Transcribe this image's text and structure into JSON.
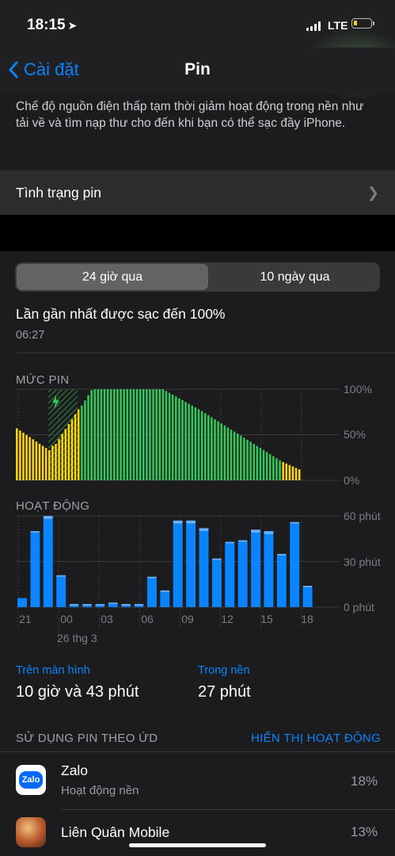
{
  "status_bar": {
    "time": "18:15",
    "network": "LTE"
  },
  "nav": {
    "back_label": "Cài đặt",
    "title": "Pin"
  },
  "low_power_description": "Chế độ nguồn điện thấp tạm thời giảm hoạt động trong nền như tải về và tìm nạp thư cho đến khi bạn có thể sạc đầy iPhone.",
  "battery_health": {
    "label": "Tình trạng pin"
  },
  "segment": {
    "options": [
      "24 giờ qua",
      "10 ngày qua"
    ],
    "selected": 0
  },
  "last_charged": {
    "label": "Lần gần nhất được sạc đến 100%",
    "time": "06:27"
  },
  "chart_data": [
    {
      "type": "bar",
      "title": "MỨC PIN",
      "y_tick_labels": [
        "100%",
        "50%",
        "0%"
      ],
      "ylim": [
        0,
        100
      ],
      "colors": {
        "normal": "#34c759",
        "low_power": "#ffd60a",
        "grid": "#3a3a3c"
      },
      "bars": 88,
      "segments": [
        {
          "from": 0,
          "to": 11,
          "start": 57,
          "end": 33,
          "mode": "low_power"
        },
        {
          "from": 11,
          "to": 12,
          "start": 38,
          "end": 38,
          "mode": "low_power"
        },
        {
          "from": 12,
          "to": 20,
          "start": 40,
          "end": 78,
          "mode": "low_power"
        },
        {
          "from": 20,
          "to": 24,
          "start": 82,
          "end": 99,
          "mode": "normal"
        },
        {
          "from": 24,
          "to": 46,
          "start": 100,
          "end": 100,
          "mode": "normal"
        },
        {
          "from": 46,
          "to": 57,
          "start": 98,
          "end": 78,
          "mode": "normal"
        },
        {
          "from": 57,
          "to": 82,
          "start": 76,
          "end": 22,
          "mode": "normal"
        },
        {
          "from": 82,
          "to": 88,
          "start": 20,
          "end": 12,
          "mode": "low_power"
        }
      ],
      "charging_window": {
        "from": 10,
        "to": 19
      }
    },
    {
      "type": "bar",
      "title": "HOẠT ĐỘNG",
      "y_tick_labels": [
        "60 phút",
        "30 phút",
        "0 phút"
      ],
      "ylim": [
        0,
        60
      ],
      "x_tick_labels": [
        "21",
        "00",
        "03",
        "06",
        "09",
        "12",
        "15",
        "18"
      ],
      "x_sublabel": "26 thg 3",
      "screen_on_minutes": [
        6,
        49,
        58,
        20,
        1,
        1,
        1,
        2,
        1,
        1,
        19,
        10,
        55,
        55,
        50,
        31,
        42,
        43,
        49,
        48,
        34,
        55,
        13
      ],
      "background_minutes": [
        0,
        1,
        2,
        1,
        1,
        1,
        1,
        1,
        1,
        1,
        1,
        1,
        2,
        2,
        2,
        1,
        1,
        1,
        2,
        2,
        1,
        1,
        1
      ],
      "colors": {
        "screen": "#0a84ff",
        "background": "#64b1ff"
      }
    }
  ],
  "summary": {
    "on_screen_label": "Trên màn hình",
    "on_screen_value": "10 giờ và 43 phút",
    "background_label": "Trong nền",
    "background_value": "27 phút"
  },
  "app_usage": {
    "title": "SỬ DỤNG PIN THEO ỨD",
    "toggle_label": "HIỂN THỊ HOẠT ĐỘNG",
    "apps": [
      {
        "name": "Zalo",
        "subtitle": "Hoạt động nền",
        "percent": "18%",
        "icon_text": "Zalo",
        "icon": "zalo-icon"
      },
      {
        "name": "Liên Quân Mobile",
        "percent": "13%",
        "icon": "lien-quan-mobile-icon"
      }
    ]
  }
}
